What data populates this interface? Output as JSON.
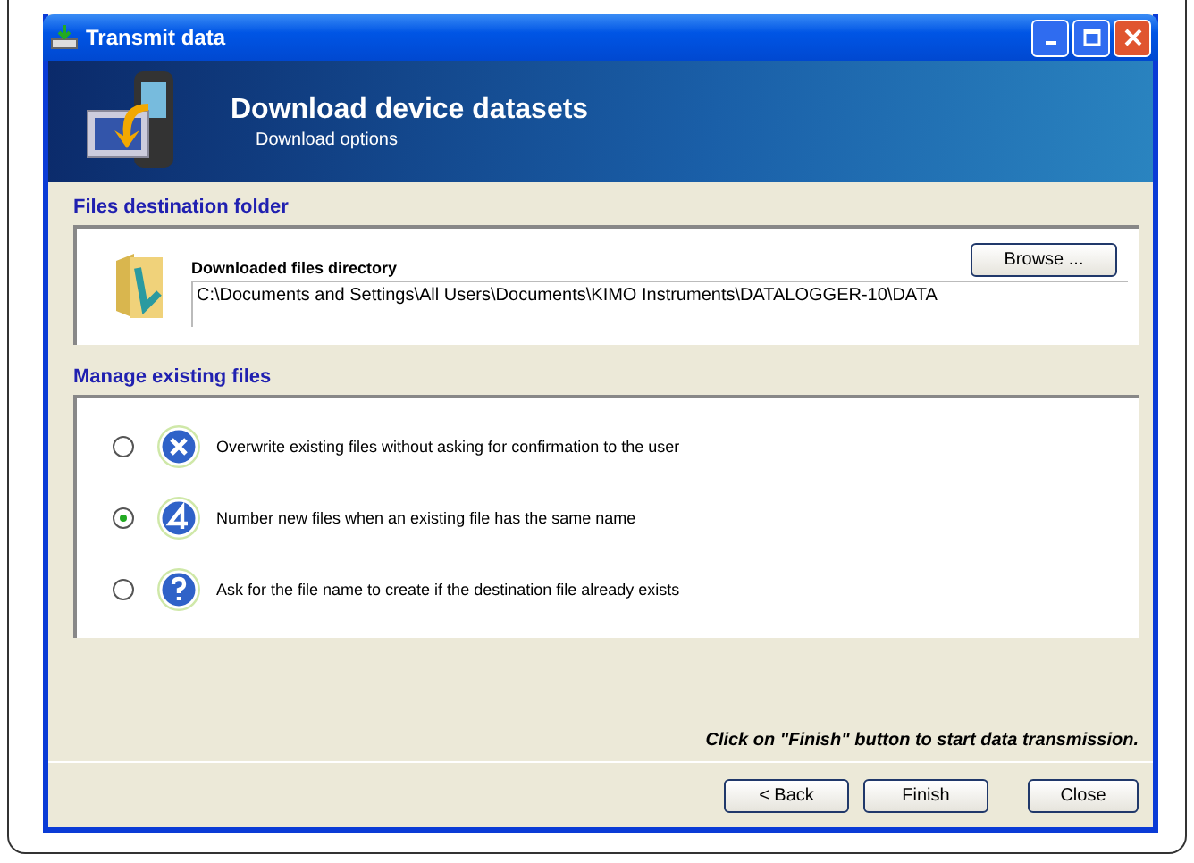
{
  "window": {
    "title": "Transmit data"
  },
  "header": {
    "title": "Download device datasets",
    "subtitle": "Download options"
  },
  "destination": {
    "section_title": "Files destination folder",
    "label": "Downloaded files directory",
    "browse_button": "Browse ...",
    "path": "C:\\Documents and Settings\\All Users\\Documents\\KIMO Instruments\\DATALOGGER-10\\DATA"
  },
  "manage": {
    "section_title": "Manage existing files",
    "options": [
      {
        "kind": "overwrite",
        "label": "Overwrite existing files without asking for confirmation to the user",
        "selected": false
      },
      {
        "kind": "number",
        "label": "Number new files when an existing file has the same name",
        "selected": true
      },
      {
        "kind": "ask",
        "label": "Ask for the file name to create if the destination file already exists",
        "selected": false
      }
    ]
  },
  "hint": "Click on \"Finish\" button to start data transmission.",
  "buttons": [
    {
      "label": "< Back"
    },
    {
      "label": "Finish"
    },
    {
      "label": "Close"
    }
  ]
}
